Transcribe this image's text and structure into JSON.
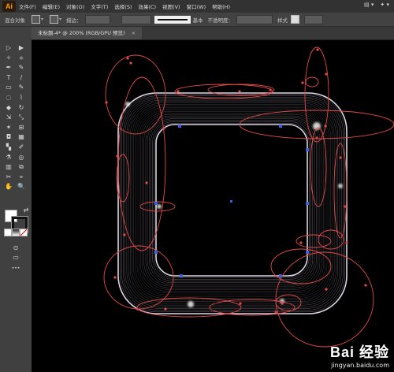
{
  "app": {
    "logo": "Ai"
  },
  "menubar": {
    "items": [
      "文件(F)",
      "编辑(E)",
      "对象(O)",
      "文字(T)",
      "选择(S)",
      "效果(C)",
      "视图(V)",
      "窗口(W)",
      "帮助(H)"
    ],
    "right": [
      "▤ ▾",
      "✦ ▾"
    ]
  },
  "controlbar": {
    "selection_label": "混合对象",
    "stroke_label": "描边：",
    "stroke_style": "基本",
    "opacity_label": "不透明度：",
    "style_label": "样式"
  },
  "document": {
    "tab_title": "未标题-4* @ 200% (RGB/GPU 预览)",
    "close": "×"
  },
  "toolbar": {
    "tools": [
      "▷",
      "▶",
      "✧",
      "⟡",
      "✒",
      "✎",
      "T",
      "/",
      "▭",
      "✎",
      "◌",
      "⌇",
      "◆",
      "↻",
      "⇲",
      "⤡",
      "✶",
      "⊞",
      "◘",
      "▦",
      "▚",
      "✐",
      "⚗",
      "◎",
      "▥",
      "⧉",
      "✂",
      "⌖",
      "✋",
      "🔍"
    ],
    "more": "•••",
    "swap": "⇄"
  },
  "colors": {
    "accent": "#ff9a00",
    "guide": "#e24a4a",
    "anchor": "#3c5ed9",
    "ring": "#cfc5d8"
  },
  "watermark": {
    "brand": "Bai 经验",
    "url": "jingyan.baidu.com"
  }
}
